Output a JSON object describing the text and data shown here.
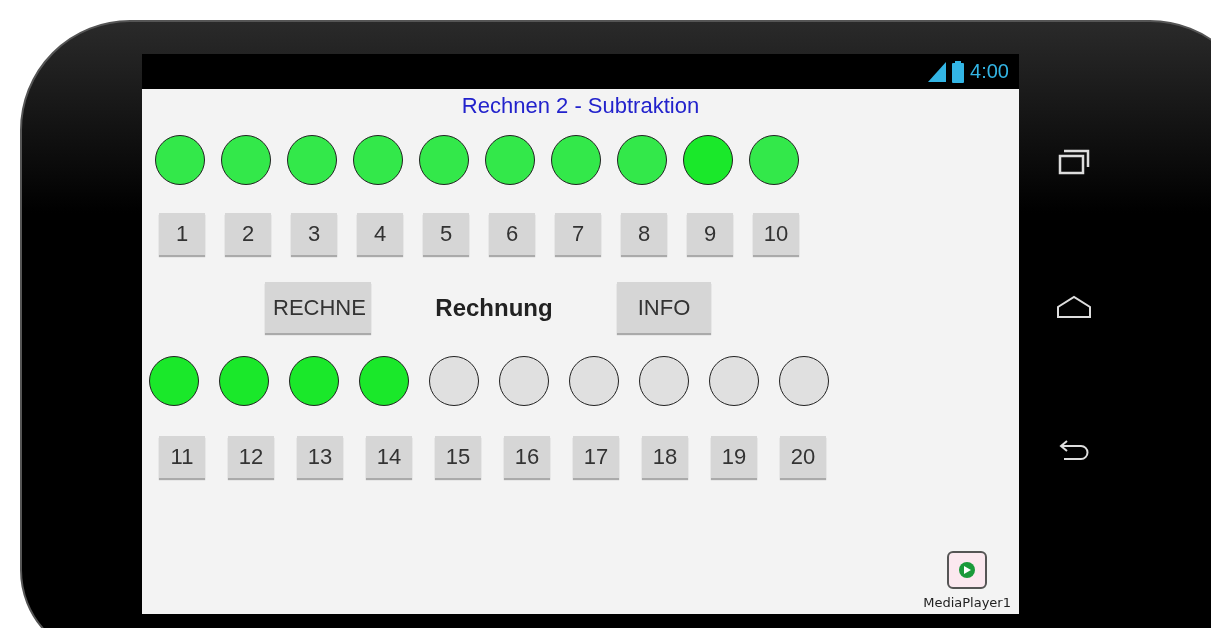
{
  "status_bar": {
    "time": "4:00"
  },
  "app": {
    "title": "Rechnen 2 - Subtraktion",
    "top_lights": [
      {
        "color": "#33e84a"
      },
      {
        "color": "#33e84a"
      },
      {
        "color": "#33e84a"
      },
      {
        "color": "#33e84a"
      },
      {
        "color": "#33e84a"
      },
      {
        "color": "#33e84a"
      },
      {
        "color": "#33e84a"
      },
      {
        "color": "#33e84a"
      },
      {
        "color": "#1ae82a"
      },
      {
        "color": "#33e84a"
      }
    ],
    "top_buttons": [
      "1",
      "2",
      "3",
      "4",
      "5",
      "6",
      "7",
      "8",
      "9",
      "10"
    ],
    "controls": {
      "rechne_button": "RECHNE",
      "label": "Rechnung",
      "info_button": "INFO"
    },
    "bottom_lights": [
      {
        "color": "#1ae82a"
      },
      {
        "color": "#1ae82a"
      },
      {
        "color": "#1ae82a"
      },
      {
        "color": "#1ae82a"
      },
      {
        "color": "#e0e0e0"
      },
      {
        "color": "#e0e0e0"
      },
      {
        "color": "#e0e0e0"
      },
      {
        "color": "#e0e0e0"
      },
      {
        "color": "#e0e0e0"
      },
      {
        "color": "#e0e0e0"
      }
    ],
    "bottom_buttons": [
      "11",
      "12",
      "13",
      "14",
      "15",
      "16",
      "17",
      "18",
      "19",
      "20"
    ],
    "media_player": {
      "label": "MediaPlayer1"
    }
  }
}
